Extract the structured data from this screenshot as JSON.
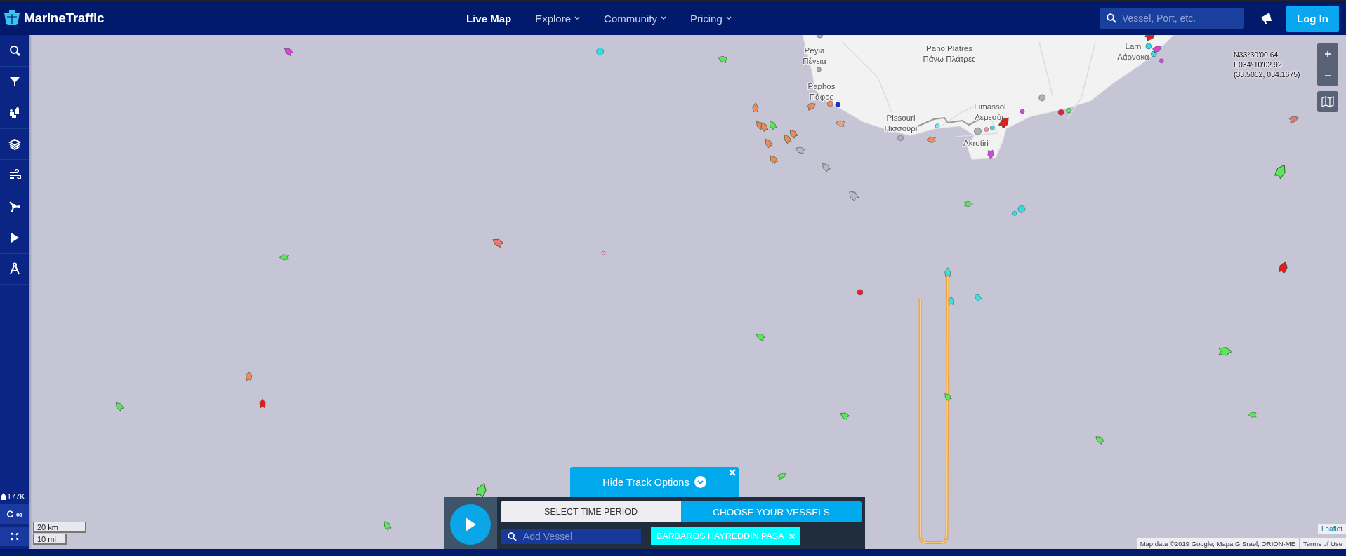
{
  "header": {
    "logo": "MarineTraffic",
    "nav": [
      {
        "label": "Live Map",
        "selected": true,
        "dropdown": false
      },
      {
        "label": "Explore",
        "selected": false,
        "dropdown": true
      },
      {
        "label": "Community",
        "selected": false,
        "dropdown": true
      },
      {
        "label": "Pricing",
        "selected": false,
        "dropdown": true
      }
    ],
    "search": {
      "placeholder": "Vessel, Port, etc."
    },
    "login": "Log In"
  },
  "sidebar": {
    "vessel_count": "177K",
    "refresh_interval": "∞"
  },
  "map": {
    "places": [
      {
        "name": "Peyia",
        "name_local": "Πέγεια"
      },
      {
        "name": "Pano Platres",
        "name_local": "Πάνω Πλάτρες"
      },
      {
        "name": "Paphos",
        "name_local": "Πάφος"
      },
      {
        "name": "Pissouri",
        "name_local": "Πισσούρι"
      },
      {
        "name": "Limassol",
        "name_local": "Λεμεσός"
      },
      {
        "name": "Akrotiri"
      },
      {
        "name": "Larn",
        "name_local": "Λάρνακα"
      }
    ],
    "coordinates": [
      "N33°30'00.64",
      "E034°10'02.92",
      "(33.5002, 034.1675)"
    ],
    "scale": [
      "20 km",
      "10 mi"
    ],
    "attribution": {
      "leaflet": "Leaflet",
      "map_data": "Map data ©2019 Google, Mapa GISrael, ORION-ME",
      "terms": "Terms of Use"
    }
  },
  "track": {
    "toggle": "Hide Track Options",
    "tabs": [
      {
        "label": "SELECT TIME PERIOD",
        "selected": false
      },
      {
        "label": "CHOOSE YOUR VESSELS",
        "selected": true
      }
    ],
    "add_vessel_placeholder": "Add Vessel",
    "vessels": [
      "BARBAROS HAYREDDIN PASA"
    ]
  }
}
